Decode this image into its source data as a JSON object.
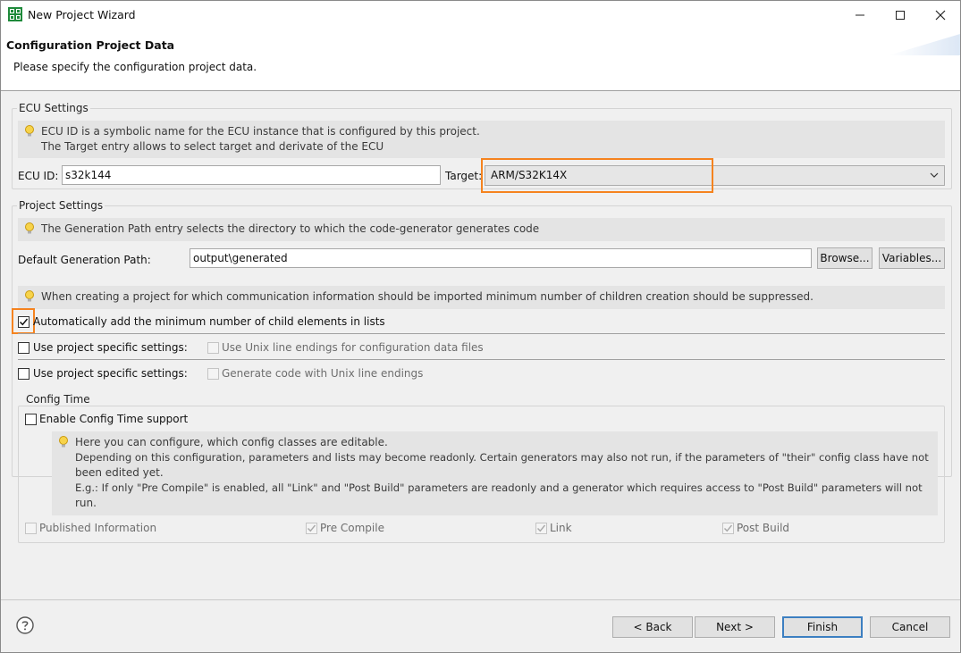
{
  "window": {
    "title": "New Project Wizard",
    "icon": "grid-app-icon",
    "controls": [
      "minimize-icon",
      "maximize-icon",
      "close-icon"
    ]
  },
  "header": {
    "title": "Configuration Project Data",
    "description": "Please specify the configuration project data."
  },
  "ecu_settings": {
    "group_label": "ECU Settings",
    "info_line1": "ECU ID is a symbolic name for the ECU instance that is configured by this project.",
    "info_line2": "The Target entry allows to select target and derivate of the ECU",
    "ecu_id_label": "ECU ID:",
    "ecu_id_value": "s32k144",
    "target_label": "Target:",
    "target_value": "ARM/S32K14X"
  },
  "project_settings": {
    "group_label": "Project Settings",
    "info_generation": "The Generation Path entry selects the directory to which the code-generator generates code",
    "default_path_label": "Default Generation Path:",
    "default_path_value": "output\\generated",
    "browse_label": "Browse...",
    "variables_label": "Variables...",
    "info_children": "When creating a project for which communication information should be imported minimum number of children creation should be suppressed.",
    "auto_add_label": "Automatically add the minimum number of child elements in lists",
    "auto_add_checked": true,
    "specific1_label": "Use project specific settings:",
    "unix_line_endings_label": "Use Unix line endings for configuration data files",
    "specific2_label": "Use project specific settings:",
    "generate_unix_label": "Generate code with Unix line endings"
  },
  "config_time": {
    "group_label": "Config Time",
    "enable_label": "Enable Config Time support",
    "info_line1": "Here you can configure, which config classes are editable.",
    "info_line2": "Depending on this configuration, parameters and lists may become readonly. Certain generators may also not run, if the parameters of \"their\" config class have not",
    "info_line3": "been edited yet.",
    "info_line4": "E.g.: If only \"Pre Compile\" is enabled, all \"Link\" and \"Post Build\" parameters are readonly and a generator which requires access to \"Post Build\" parameters will not",
    "info_line5": "run.",
    "classes": {
      "published": "Published Information",
      "pre_compile": "Pre Compile",
      "link": "Link",
      "post_build": "Post Build"
    }
  },
  "footer": {
    "help_icon": "help-icon",
    "back_label": "< Back",
    "next_label": "Next >",
    "finish_label": "Finish",
    "cancel_label": "Cancel"
  },
  "colors": {
    "highlight": "#f5831f",
    "default_button_border": "#3c7fc1",
    "info_bg": "#e4e4e4"
  }
}
